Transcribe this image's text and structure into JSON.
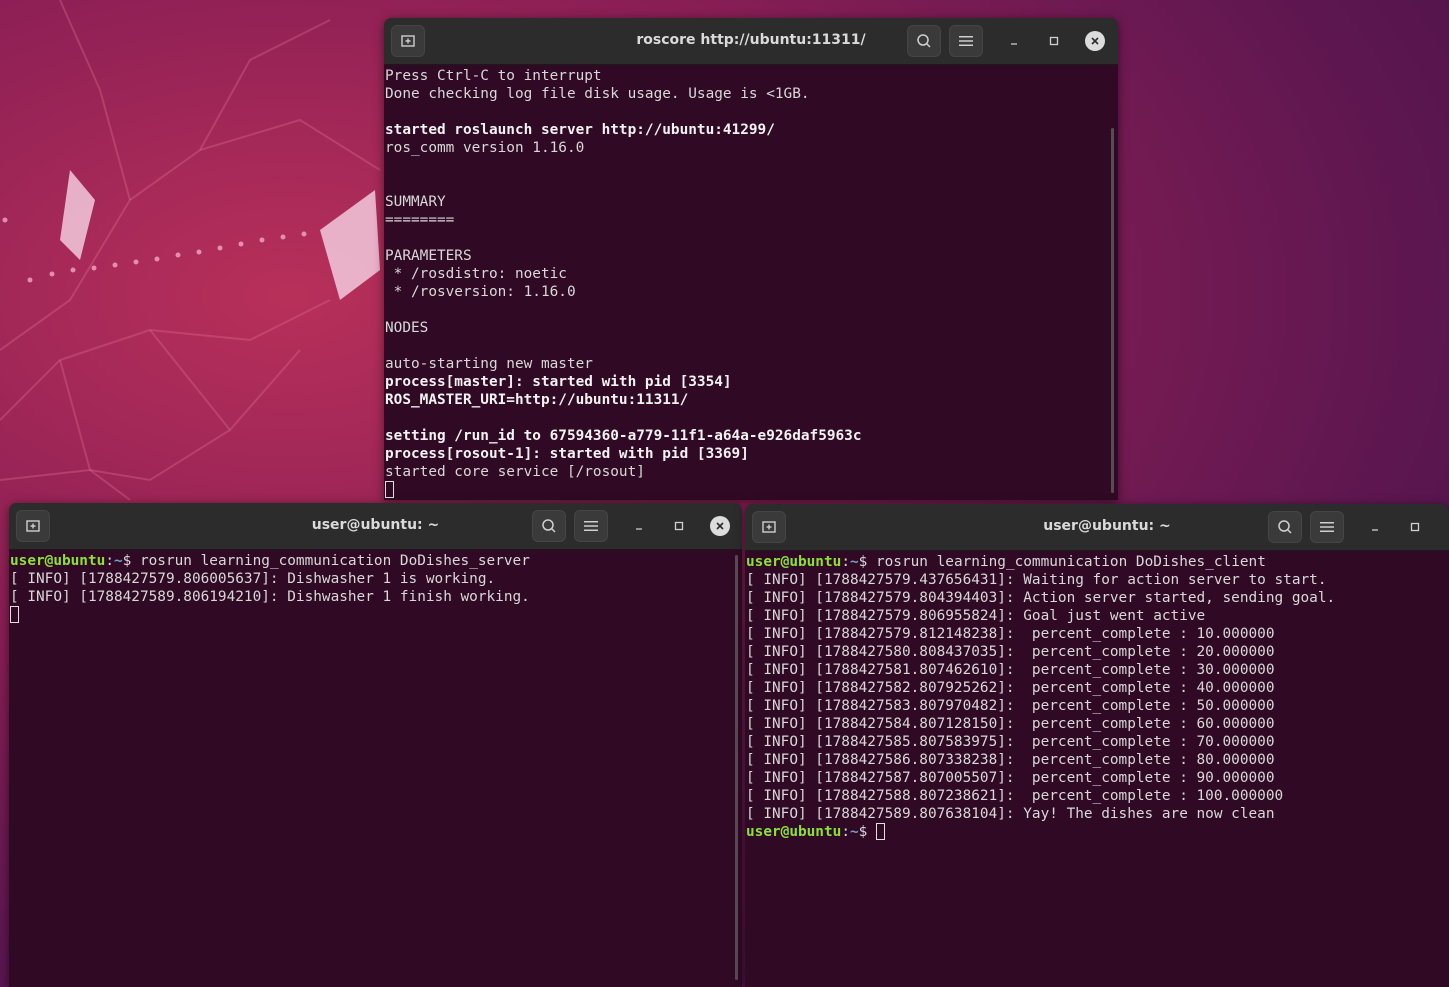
{
  "desktop": {
    "wallpaper": "ubuntu-20.04-focal-fossa"
  },
  "colors": {
    "terminal_bg": "#300a24",
    "titlebar_bg": "#2c2c2c",
    "prompt_user": "#8ae234",
    "prompt_path": "#729fcf",
    "text": "#d8d8d8"
  },
  "windows": {
    "roscore": {
      "title": "roscore http://ubuntu:11311/",
      "lines": [
        {
          "text": "Press Ctrl-C to interrupt",
          "bold": false
        },
        {
          "text": "Done checking log file disk usage. Usage is <1GB.",
          "bold": false
        },
        {
          "text": "",
          "bold": false
        },
        {
          "text": "started roslaunch server http://ubuntu:41299/",
          "bold": true
        },
        {
          "text": "ros_comm version 1.16.0",
          "bold": false
        },
        {
          "text": "",
          "bold": false
        },
        {
          "text": "",
          "bold": false
        },
        {
          "text": "SUMMARY",
          "bold": false
        },
        {
          "text": "========",
          "bold": false
        },
        {
          "text": "",
          "bold": false
        },
        {
          "text": "PARAMETERS",
          "bold": false
        },
        {
          "text": " * /rosdistro: noetic",
          "bold": false
        },
        {
          "text": " * /rosversion: 1.16.0",
          "bold": false
        },
        {
          "text": "",
          "bold": false
        },
        {
          "text": "NODES",
          "bold": false
        },
        {
          "text": "",
          "bold": false
        },
        {
          "text": "auto-starting new master",
          "bold": false
        },
        {
          "text": "process[master]: started with pid [3354]",
          "bold": true
        },
        {
          "text": "ROS_MASTER_URI=http://ubuntu:11311/",
          "bold": true
        },
        {
          "text": "",
          "bold": false
        },
        {
          "text": "setting /run_id to 67594360-a779-11f1-a64a-e926daf5963c",
          "bold": true
        },
        {
          "text": "process[rosout-1]: started with pid [3369]",
          "bold": true
        },
        {
          "text": "started core service [/rosout]",
          "bold": false
        }
      ]
    },
    "server": {
      "title": "user@ubuntu: ~",
      "prompt_user": "user@ubuntu",
      "prompt_sep": ":",
      "prompt_path": "~",
      "prompt_dollar": "$ ",
      "command": "rosrun learning_communication DoDishes_server",
      "lines": [
        "[ INFO] [1788427579.806005637]: Dishwasher 1 is working.",
        "[ INFO] [1788427589.806194210]: Dishwasher 1 finish working."
      ]
    },
    "client": {
      "title": "user@ubuntu: ~",
      "prompt_user": "user@ubuntu",
      "prompt_sep": ":",
      "prompt_path": "~",
      "prompt_dollar": "$ ",
      "command": "rosrun learning_communication DoDishes_client",
      "lines": [
        "[ INFO] [1788427579.437656431]: Waiting for action server to start.",
        "[ INFO] [1788427579.804394403]: Action server started, sending goal.",
        "[ INFO] [1788427579.806955824]: Goal just went active",
        "[ INFO] [1788427579.812148238]:  percent_complete : 10.000000",
        "[ INFO] [1788427580.808437035]:  percent_complete : 20.000000",
        "[ INFO] [1788427581.807462610]:  percent_complete : 30.000000",
        "[ INFO] [1788427582.807925262]:  percent_complete : 40.000000",
        "[ INFO] [1788427583.807970482]:  percent_complete : 50.000000",
        "[ INFO] [1788427584.807128150]:  percent_complete : 60.000000",
        "[ INFO] [1788427585.807583975]:  percent_complete : 70.000000",
        "[ INFO] [1788427586.807338238]:  percent_complete : 80.000000",
        "[ INFO] [1788427587.807005507]:  percent_complete : 90.000000",
        "[ INFO] [1788427588.807238621]:  percent_complete : 100.000000",
        "[ INFO] [1788427589.807638104]: Yay! The dishes are now clean"
      ]
    }
  }
}
